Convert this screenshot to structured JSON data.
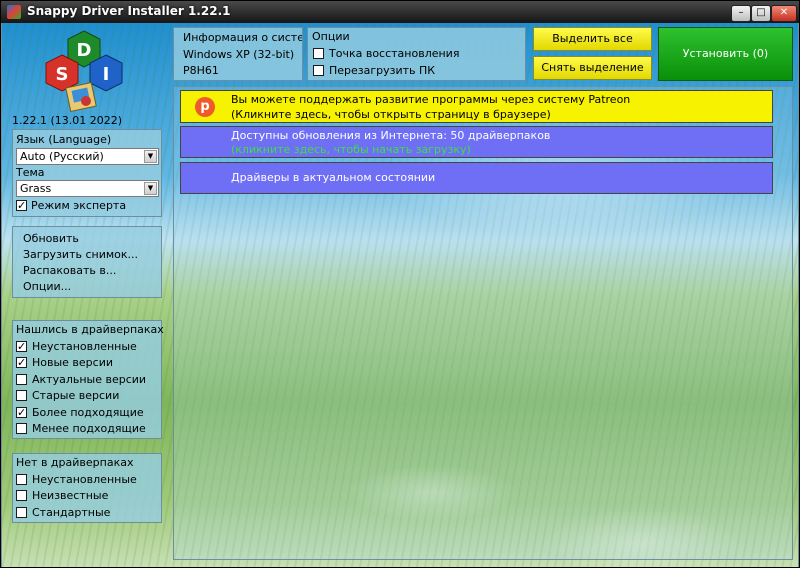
{
  "window": {
    "title": "Snappy Driver Installer 1.22.1"
  },
  "version": "1.22.1 (13.01 2022)",
  "logo_letters": [
    "D",
    "S",
    "I"
  ],
  "sysinfo": {
    "title": "Информация о системе",
    "os": "Windows XP (32-bit)",
    "board": "P8H61"
  },
  "options": {
    "title": "Опции",
    "restore_point": {
      "label": "Точка восстановления",
      "checked": false
    },
    "reboot": {
      "label": "Перезагрузить ПК",
      "checked": false
    }
  },
  "buttons": {
    "select_all": "Выделить все",
    "deselect": "Снять выделение",
    "install": "Установить (0)"
  },
  "lang": {
    "label": "Язык (Language)",
    "value": "Auto (Русский)"
  },
  "theme": {
    "label": "Тема",
    "value": "Grass"
  },
  "expert": {
    "label": "Режим эксперта",
    "checked": true
  },
  "menu": [
    "Обновить",
    "Загрузить снимок...",
    "Распаковать в...",
    "Опции..."
  ],
  "found": {
    "title": "Нашлись в драйверпаках",
    "items": [
      {
        "label": "Неустановленные",
        "checked": true
      },
      {
        "label": "Новые версии",
        "checked": true
      },
      {
        "label": "Актуальные версии",
        "checked": false
      },
      {
        "label": "Старые версии",
        "checked": false
      },
      {
        "label": "Более подходящие",
        "checked": true
      },
      {
        "label": "Менее подходящие",
        "checked": false
      }
    ]
  },
  "notfound": {
    "title": "Нет в драйверпаках",
    "items": [
      {
        "label": "Неустановленные",
        "checked": false
      },
      {
        "label": "Неизвестные",
        "checked": false
      },
      {
        "label": "Стандартные",
        "checked": false
      }
    ]
  },
  "banners": {
    "patreon": {
      "line1": "Вы можете поддержать развитие программы через систему Patreon",
      "line2": "(Кликните здесь, чтобы открыть страницу в браузере)"
    },
    "updates": {
      "line1": "Доступны обновления из Интернета: 50 драйверпаков",
      "line2": "(кликните здесь, чтобы начать загрузку)"
    },
    "uptodate": {
      "line1": "Драйверы в актуальном состоянии"
    }
  },
  "colors": {
    "patreon_bg": "#f7f200",
    "blue_banner": "#6f6ff5",
    "green_link": "#3ce03c",
    "install_bg": "#0fa70f"
  }
}
